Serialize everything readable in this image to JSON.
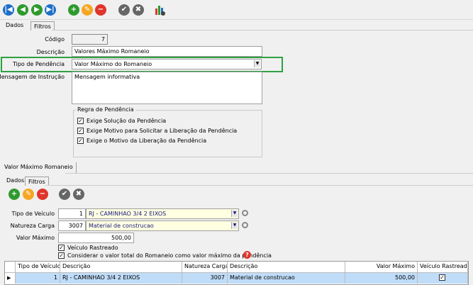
{
  "toolbar": {
    "icons": [
      "first-icon",
      "previous-icon",
      "next-icon",
      "last-icon",
      "add-icon",
      "edit-icon",
      "delete-icon",
      "confirm-icon",
      "cancel-icon",
      "report-settings-icon"
    ]
  },
  "tabs": [
    {
      "label": "Dados"
    },
    {
      "label": "Filtros"
    }
  ],
  "form": {
    "codigo_label": "Código",
    "codigo": "7",
    "descricao_label": "Descrição",
    "descricao": "Valores Máximo Romaneio",
    "tipo_label": "Tipo de Pendência",
    "tipo": "Valor Máximo do Romaneio",
    "mensagem_label": "Mensagem de Instrução",
    "mensagem": "Mensagem informativa",
    "regra": {
      "title": "Regra de Pendência",
      "items": [
        {
          "label": "Exige Solução da Pendência",
          "checked": true
        },
        {
          "label": "Exige Motivo para Solicitar a Liberação da Pendência",
          "checked": true
        },
        {
          "label": "Exige o Motivo da Liberação da Pendência",
          "checked": true
        }
      ]
    }
  },
  "highlight_color": "#2ea043",
  "section_tab": "Valor Máximo Romaneio",
  "sub_tabs": [
    {
      "label": "Dados"
    },
    {
      "label": "Filtros"
    }
  ],
  "sub": {
    "tipo_veiculo_label": "Tipo de Veículo",
    "tipo_veiculo_code": "1",
    "tipo_veiculo": "RJ - CAMINHAO 3/4 2 EIXOS",
    "natureza_label": "Natureza Carga",
    "natureza_code": "3007",
    "natureza": "Material de construcao",
    "valor_label": "Valor Máximo",
    "valor": "500,00",
    "rastreado_label": "Veículo Rastreado",
    "rastreado": true,
    "considerar_label": "Considerar o valor total do Romaneio como valor máximo da pendência",
    "considerar": true
  },
  "grid": {
    "columns": [
      "Tipo de Veículo",
      "Descrição",
      "Natureza Carga",
      "Descrição",
      "Valor Máximo",
      "Veículo Rastreado"
    ],
    "rows": [
      {
        "tipo": "1",
        "descricao": "RJ - CAMINHAO 3/4 2 EIXOS",
        "natureza": "3007",
        "natureza_desc": "Material de construcao",
        "valor": "500,00",
        "rastreado": true
      }
    ]
  }
}
